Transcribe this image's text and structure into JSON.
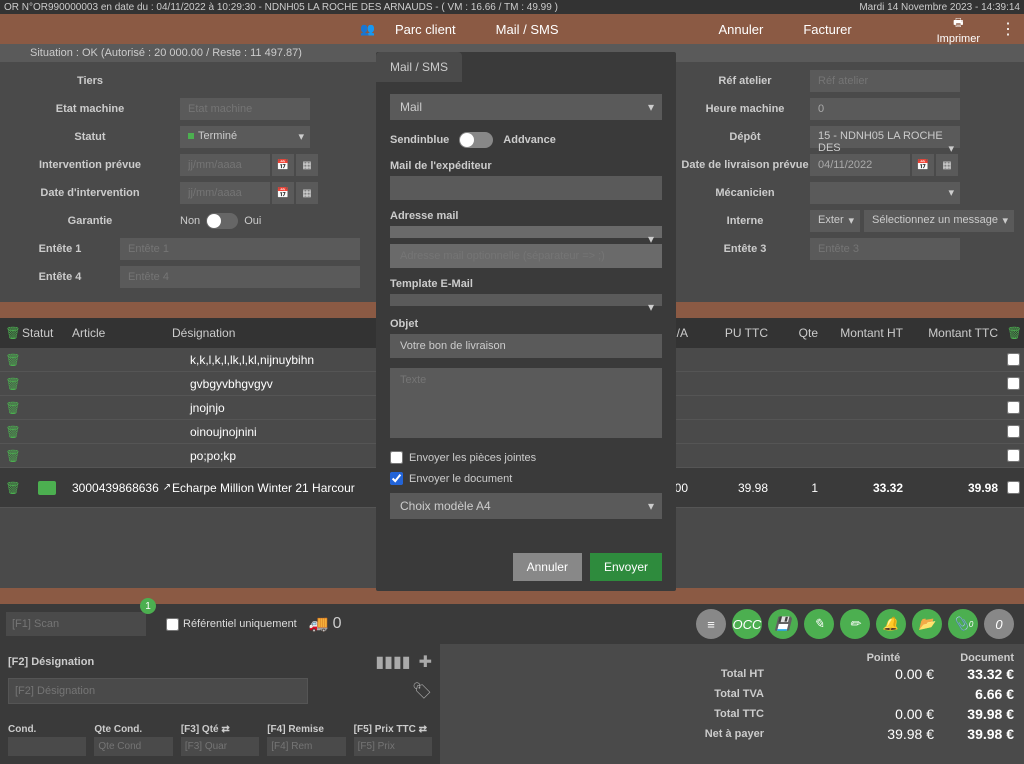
{
  "topbar": {
    "left": "OR N°OR990000003 en date du : 04/11/2022 à 10:29:30 - NDNH05 LA ROCHE DES ARNAUDS - ( VM : 16.66 / TM : 49.99 )",
    "right": "Mardi 14 Novembre 2023 - 14:39:14"
  },
  "header": {
    "parc": "Parc client",
    "mailsms": "Mail / SMS",
    "annuler": "Annuler",
    "facturer": "Facturer",
    "imprimer": "Imprimer"
  },
  "situation": "Situation : OK (Autorisé : 20 000.00 / Reste : 11 497.87)",
  "form": {
    "tiers": "Tiers",
    "etat_machine": "Etat machine",
    "etat_machine_ph": "Etat machine",
    "statut": "Statut",
    "statut_val": "Terminé",
    "intervention_prevue": "Intervention prévue",
    "date_ph": "jj/mm/aaaa",
    "date_intervention": "Date d'intervention",
    "garantie": "Garantie",
    "non": "Non",
    "oui": "Oui",
    "entete1": "Entête 1",
    "entete1_ph": "Entête 1",
    "entete4": "Entête 4",
    "entete4_ph": "Entête 4",
    "ref_atelier": "Réf atelier",
    "ref_atelier_ph": "Réf atelier",
    "heure_machine": "Heure machine",
    "heure_machine_val": "0",
    "depot": "Dépôt",
    "depot_val": "15 - NDNH05 LA ROCHE DES",
    "date_livraison": "Date de livraison prévue",
    "date_livraison_val": "04/11/2022",
    "mecanicien": "Mécanicien",
    "interne": "Interne",
    "exter": "Exter",
    "select_msg": "Sélectionnez un message",
    "entete3": "Entête 3",
    "entete3_ph": "Entête 3"
  },
  "table": {
    "h_statut": "Statut",
    "h_article": "Article",
    "h_designation": "Désignation",
    "h_va": "/A",
    "h_puttc": "PU TTC",
    "h_qte": "Qte",
    "h_montantht": "Montant HT",
    "h_montantttc": "Montant TTC",
    "rows": [
      {
        "des": "k,k,l,k,l,lk,l,kl,nijnuybihn"
      },
      {
        "des": "gvbgyvbhgvgyv"
      },
      {
        "des": "jnojnjo"
      },
      {
        "des": "oinoujnojnini"
      },
      {
        "des": "po;po;kp"
      }
    ],
    "product": {
      "article": "3000439868636",
      "des": "Echarpe Million Winter 21 Harcour",
      "v00": "00",
      "puttc": "39.98",
      "qte": "1",
      "ht": "33.32",
      "ttc": "39.98"
    }
  },
  "scan": {
    "ph": "[F1] Scan",
    "badge": "1",
    "ref": "Référentiel uniquement",
    "truck_count": "0",
    "occ": "OCC",
    "attach_count": "0",
    "zero": "0"
  },
  "bottom": {
    "f2": "[F2] Désignation",
    "f2_ph": "[F2] Désignation",
    "cond": "Cond.",
    "qte_cond": "Qte Cond.",
    "qte_cond_ph": "Qte Cond",
    "f3": "[F3] Qté",
    "f3_ph": "[F3] Quar",
    "f4": "[F4] Remise",
    "f4_ph": "[F4] Rem",
    "f5": "[F5] Prix TTC",
    "f5_ph": "[F5] Prix"
  },
  "totals": {
    "pointe": "Pointé",
    "document": "Document",
    "total_ht": "Total HT",
    "total_ht_p": "0.00 €",
    "total_ht_d": "33.32 €",
    "total_tva": "Total TVA",
    "total_tva_d": "6.66 €",
    "total_ttc": "Total TTC",
    "total_ttc_p": "0.00 €",
    "total_ttc_d": "39.98 €",
    "net": "Net à payer",
    "net_p": "39.98 €",
    "net_d": "39.98 €"
  },
  "modal": {
    "tab": "Mail / SMS",
    "mail": "Mail",
    "sendinblue": "Sendinblue",
    "advance": "Addvance",
    "mail_exp": "Mail de l'expéditeur",
    "adresse_mail": "Adresse mail",
    "adresse_opt_ph": "Adresse mail optionnelle (séparateur => ;)",
    "template": "Template E-Mail",
    "objet": "Objet",
    "objet_val": "Votre bon de livraison",
    "texte_ph": "Texte",
    "pieces": "Envoyer les pièces jointes",
    "doc": "Envoyer le document",
    "modele": "Choix modèle A4",
    "annuler": "Annuler",
    "envoyer": "Envoyer"
  }
}
